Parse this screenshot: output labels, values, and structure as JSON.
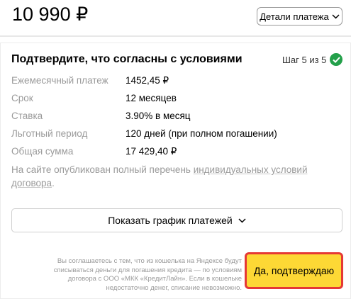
{
  "header": {
    "price": "10 990 ₽",
    "details_label": "Детали платежа"
  },
  "card": {
    "heading": "Подтвердите, что согласны с условиями",
    "step": "Шаг 5 из 5"
  },
  "terms": [
    {
      "label": "Ежемесячный платеж",
      "value": "1452,45 ₽"
    },
    {
      "label": "Срок",
      "value": "12 месяцев"
    },
    {
      "label": "Ставка",
      "value": "3.90% в месяц"
    },
    {
      "label": "Льготный период",
      "value": "120 дней (при полном погашении)"
    },
    {
      "label": "Общая сумма",
      "value": "17 429,40 ₽"
    }
  ],
  "note": {
    "text": "На сайте опубликован полный перечень ",
    "link": "индивидуальных условий договора",
    "end": "."
  },
  "schedule_label": "Показать график платежей",
  "legal": "Вы соглашаетесь с тем, что из кошелька на Яндексе будут списываться деньги для погашения кредита — по условиям договора с ООО «МКК «КредитЛайн». Если в кошельке недостаточно денег, списание невозможно.",
  "confirm_label": "Да, подтверждаю",
  "colors": {
    "accent": "#fdd835",
    "highlight_border": "#e53935",
    "success": "#23a04a",
    "muted_text": "#9a9a9a"
  },
  "icons": {
    "details_chevron": "chevron-down-icon",
    "schedule_chevron": "chevron-down-icon",
    "step_check": "check-circle-icon"
  }
}
